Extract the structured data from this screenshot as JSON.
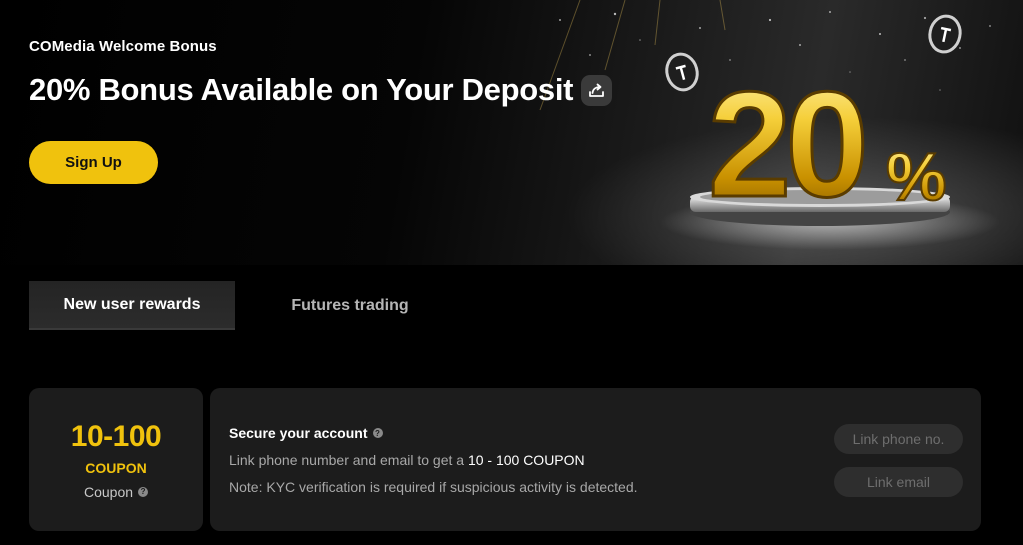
{
  "hero": {
    "label": "COMedia Welcome Bonus",
    "title": "20% Bonus Available on Your Deposit",
    "signup_label": "Sign Up",
    "share_icon": "share-icon",
    "art_text": "20",
    "art_percent": "%",
    "colors": {
      "accent": "#f0c20d",
      "gold_light": "#fff1a6",
      "gold_dark": "#a57400"
    }
  },
  "tabs": [
    {
      "label": "New user rewards",
      "active": true
    },
    {
      "label": "Futures trading",
      "active": false
    }
  ],
  "coupon_card": {
    "range": "10-100",
    "unit": "COUPON",
    "sub_label": "Coupon",
    "help_glyph": "?"
  },
  "task_card": {
    "title": "Secure your account",
    "help_glyph": "?",
    "desc_prefix": "Link phone number and email to get a ",
    "desc_highlight": "10 - 100 COUPON",
    "note": "Note: KYC verification is required if suspicious activity is detected.",
    "btn_phone": "Link phone no.",
    "btn_email": "Link email"
  }
}
